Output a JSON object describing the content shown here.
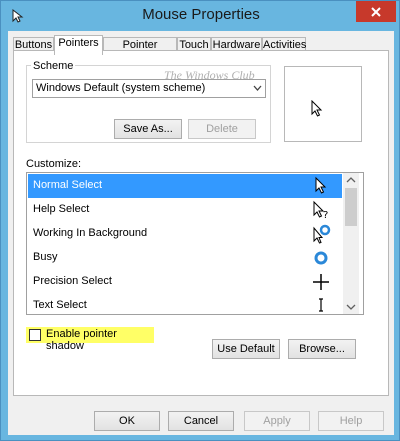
{
  "window": {
    "title": "Mouse Properties"
  },
  "tabs": [
    {
      "label": "Buttons",
      "active": false
    },
    {
      "label": "Pointers",
      "active": true
    },
    {
      "label": "Pointer Options",
      "active": false
    },
    {
      "label": "Touch",
      "active": false
    },
    {
      "label": "Hardware",
      "active": false
    },
    {
      "label": "Activities",
      "active": false
    }
  ],
  "scheme": {
    "label": "Scheme",
    "selected": "Windows Default (system scheme)",
    "watermark": "The Windows Club",
    "save_as_label": "Save As...",
    "delete_label": "Delete"
  },
  "customize": {
    "label": "Customize:",
    "items": [
      {
        "label": "Normal Select",
        "selected": true,
        "icon": "arrow-cursor-icon"
      },
      {
        "label": "Help Select",
        "selected": false,
        "icon": "help-cursor-icon"
      },
      {
        "label": "Working In Background",
        "selected": false,
        "icon": "working-cursor-icon"
      },
      {
        "label": "Busy",
        "selected": false,
        "icon": "busy-cursor-icon"
      },
      {
        "label": "Precision Select",
        "selected": false,
        "icon": "crosshair-cursor-icon"
      },
      {
        "label": "Text Select",
        "selected": false,
        "icon": "text-cursor-icon"
      }
    ]
  },
  "shadow": {
    "label": "Enable pointer shadow",
    "checked": false
  },
  "actions": {
    "use_default_label": "Use Default",
    "browse_label": "Browse..."
  },
  "footer": {
    "ok_label": "OK",
    "cancel_label": "Cancel",
    "apply_label": "Apply",
    "help_label": "Help"
  },
  "colors": {
    "frame": "#68b6e0",
    "close": "#c7392b",
    "selection": "#3399ff",
    "highlight": "#ffff66",
    "busy_blue": "#2b88d8"
  }
}
